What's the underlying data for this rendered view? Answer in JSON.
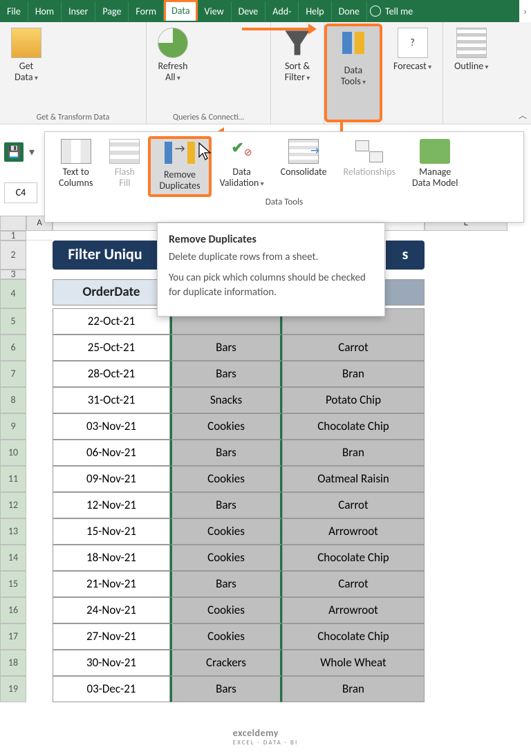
{
  "tabs": [
    "File",
    "Hom",
    "Inser",
    "Page",
    "Form",
    "Data",
    "View",
    "Deve",
    "Add-",
    "Help",
    "Done"
  ],
  "active_tab": "Data",
  "tellme": "Tell me",
  "ribbon": {
    "groups": [
      {
        "label": "Get & Transform Data",
        "buttons": [
          {
            "l1": "Get",
            "l2": "Data"
          }
        ]
      },
      {
        "label": "Queries & Connecti…",
        "buttons": [
          {
            "l1": "Refresh",
            "l2": "All"
          }
        ]
      },
      {
        "label": "",
        "buttons": [
          {
            "l1": "Sort &",
            "l2": "Filter"
          }
        ]
      },
      {
        "label": "",
        "buttons": [
          {
            "l1": "Data",
            "l2": "Tools"
          }
        ],
        "highlight": true
      },
      {
        "label": "",
        "buttons": [
          {
            "l1": "Forecast",
            "l2": ""
          }
        ]
      },
      {
        "label": "",
        "buttons": [
          {
            "l1": "Outline",
            "l2": ""
          }
        ]
      }
    ]
  },
  "datatools": {
    "label": "Data Tools",
    "items": [
      {
        "l1": "Text to",
        "l2": "Columns"
      },
      {
        "l1": "Flash",
        "l2": "Fill",
        "disabled": true
      },
      {
        "l1": "Remove",
        "l2": "Duplicates",
        "highlight": true
      },
      {
        "l1": "Data",
        "l2": "Validation",
        "drop": true
      },
      {
        "l1": "Consolidate",
        "l2": ""
      },
      {
        "l1": "Relationships",
        "l2": "",
        "disabled": true
      },
      {
        "l1": "Manage",
        "l2": "Data Model"
      }
    ]
  },
  "tooltip": {
    "title": "Remove Duplicates",
    "p1": "Delete duplicate rows from a sheet.",
    "p2": "You can pick which columns should be checked for duplicate information."
  },
  "namebox": "C4",
  "row_headers": [
    "1",
    "2",
    "3",
    "4",
    "5",
    "6",
    "7",
    "8",
    "9",
    "10",
    "11",
    "12",
    "13",
    "14",
    "15",
    "16",
    "17",
    "18",
    "19"
  ],
  "col_headers": {
    "A": "A",
    "E": "E"
  },
  "sheet_title": "Filter Uniqu",
  "sheet_title_suffix": "s",
  "table": {
    "headers": [
      "OrderDate",
      "",
      ""
    ],
    "rows": [
      [
        "22-Oct-21",
        "",
        ""
      ],
      [
        "25-Oct-21",
        "Bars",
        "Carrot"
      ],
      [
        "28-Oct-21",
        "Bars",
        "Bran"
      ],
      [
        "31-Oct-21",
        "Snacks",
        "Potato Chip"
      ],
      [
        "03-Nov-21",
        "Cookies",
        "Chocolate Chip"
      ],
      [
        "06-Nov-21",
        "Bars",
        "Bran"
      ],
      [
        "09-Nov-21",
        "Cookies",
        "Oatmeal Raisin"
      ],
      [
        "12-Nov-21",
        "Bars",
        "Carrot"
      ],
      [
        "15-Nov-21",
        "Cookies",
        "Arrowroot"
      ],
      [
        "18-Nov-21",
        "Cookies",
        "Chocolate Chip"
      ],
      [
        "21-Nov-21",
        "Bars",
        "Carrot"
      ],
      [
        "24-Nov-21",
        "Cookies",
        "Arrowroot"
      ],
      [
        "27-Nov-21",
        "Cookies",
        "Chocolate Chip"
      ],
      [
        "30-Nov-21",
        "Crackers",
        "Whole Wheat"
      ],
      [
        "03-Dec-21",
        "Bars",
        "Bran"
      ]
    ]
  },
  "watermark": {
    "brand": "exceldemy",
    "tag": "EXCEL · DATA · BI"
  },
  "col_widths": {
    "row": 38,
    "A": 38,
    "B": 170,
    "C": 162,
    "D": 206
  }
}
